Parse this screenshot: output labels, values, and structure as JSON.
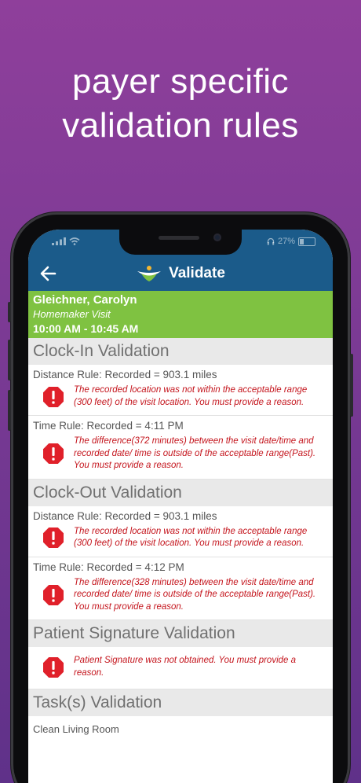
{
  "headline": {
    "line1": "payer specific",
    "line2": "validation rules"
  },
  "status_bar": {
    "battery": "27%"
  },
  "app_bar": {
    "title": "Validate"
  },
  "visit": {
    "client_name": "Gleichner, Carolyn",
    "visit_type": "Homemaker Visit",
    "time_range": "10:00 AM - 10:45 AM"
  },
  "sections": {
    "clock_in": {
      "title": "Clock-In Validation",
      "distance_rule": {
        "title": "Distance Rule: Recorded = 903.1 miles",
        "message": "The recorded location was not within the acceptable range (300 feet) of the visit location. You must provide a reason."
      },
      "time_rule": {
        "title": "Time Rule: Recorded = 4:11 PM",
        "message": "The difference(372 minutes) between the visit date/time and recorded date/ time is outside of the acceptable range(Past).  You must provide a reason."
      }
    },
    "clock_out": {
      "title": "Clock-Out Validation",
      "distance_rule": {
        "title": "Distance Rule: Recorded = 903.1 miles",
        "message": "The recorded location was not within the acceptable range (300 feet) of the visit location. You must provide a reason."
      },
      "time_rule": {
        "title": "Time Rule: Recorded = 4:12 PM",
        "message": "The difference(328 minutes) between the visit date/time and recorded date/ time is outside of the acceptable range(Past).  You must provide a reason."
      }
    },
    "signature": {
      "title": "Patient Signature Validation",
      "message": "Patient Signature was not obtained. You must provide a reason."
    },
    "tasks": {
      "title": "Task(s) Validation",
      "items": [
        "Clean Living Room"
      ]
    }
  },
  "colors": {
    "background_purple": "#7a3a94",
    "app_bar_blue": "#1b5b8a",
    "visit_green": "#7fc241",
    "warning_red": "#e0202a",
    "message_red": "#c4141c",
    "section_gray": "#e9e9e9"
  },
  "icons": {
    "back": "arrow-left-icon",
    "logo": "people-leaf-logo-icon",
    "warning": "octagon-exclamation-icon",
    "wifi": "wifi-icon",
    "signal": "signal-bars-icon",
    "battery": "battery-icon"
  }
}
